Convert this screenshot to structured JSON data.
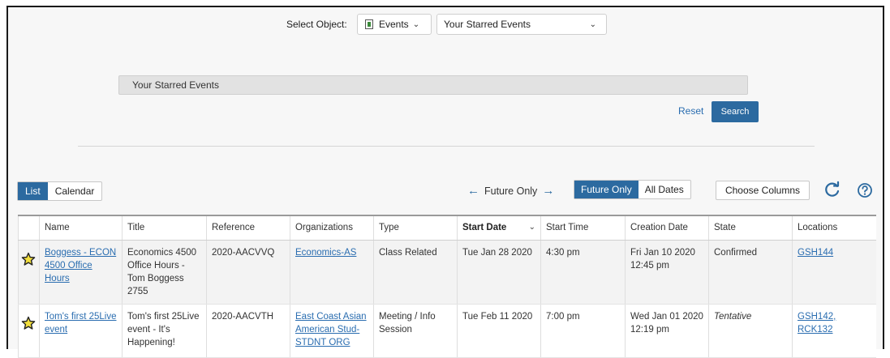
{
  "select_object": {
    "label": "Select Object:",
    "object_value": "Events",
    "search_value": "Your Starred Events"
  },
  "search_panel": {
    "starred_bar": "Your Starred Events",
    "reset": "Reset",
    "search": "Search"
  },
  "view": {
    "list": "List",
    "calendar": "Calendar",
    "future_nav": "Future Only",
    "future_only": "Future Only",
    "all_dates": "All Dates",
    "choose_columns": "Choose Columns"
  },
  "colors": {
    "accent": "#2c6aa0",
    "link": "#2a6db0"
  },
  "table": {
    "columns": [
      "Name",
      "Title",
      "Reference",
      "Organizations",
      "Type",
      "Start Date",
      "Start Time",
      "Creation Date",
      "State",
      "Locations"
    ],
    "rows": [
      {
        "name": "Boggess - ECON 4500 Office Hours",
        "title": "Economics 4500 Office Hours - Tom Boggess 2755",
        "reference": "2020-AACVVQ",
        "organizations": "Economics-AS",
        "type": "Class Related",
        "start_date": "Tue Jan 28 2020",
        "start_time": "4:30 pm",
        "creation_date": "Fri Jan 10 2020 12:45 pm",
        "state": "Confirmed",
        "locations": "GSH144"
      },
      {
        "name": "Tom's first 25Live event",
        "title": "Tom's first 25Live event - It's Happening!",
        "reference": "2020-AACVTH",
        "organizations": "East Coast Asian American Stud-STDNT ORG",
        "type": "Meeting / Info Session",
        "start_date": "Tue Feb 11 2020",
        "start_time": "7:00 pm",
        "creation_date": "Wed Jan 01 2020 12:19 pm",
        "state": "Tentative",
        "locations": "GSH142, RCK132"
      }
    ]
  }
}
